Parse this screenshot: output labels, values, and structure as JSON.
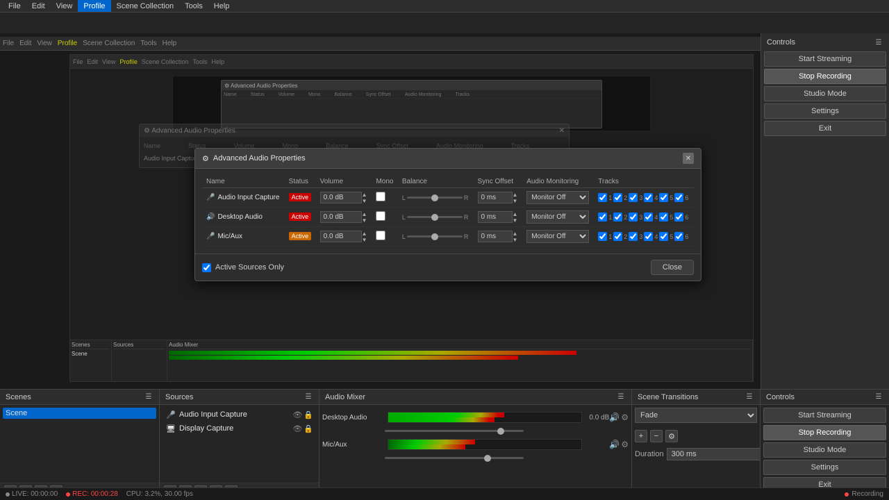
{
  "menubar": {
    "items": [
      "File",
      "Edit",
      "View",
      "Profile",
      "Scene Collection",
      "Tools",
      "Help"
    ]
  },
  "obs_menubar": {
    "items": [
      "File",
      "Edit",
      "View",
      "Profile",
      "Scene Collection",
      "Tools",
      "Help"
    ]
  },
  "dialog": {
    "title": "Advanced Audio Properties",
    "icon": "⚙",
    "columns": [
      "Name",
      "Status",
      "Volume",
      "Mono",
      "Balance",
      "Sync Offset",
      "Audio Monitoring",
      "Tracks"
    ],
    "rows": [
      {
        "name": "Audio Input Capture",
        "status": "Active",
        "volume": "0.0 dB",
        "mono": false,
        "balance_l": "L",
        "balance_r": "R",
        "sync_offset": "0 ms",
        "monitoring": "Monitor Off",
        "tracks": [
          true,
          true,
          true,
          true,
          true,
          true
        ]
      },
      {
        "name": "Desktop Audio",
        "status": "Active",
        "volume": "0.0 dB",
        "mono": false,
        "balance_l": "L",
        "balance_r": "R",
        "sync_offset": "0 ms",
        "monitoring": "Monitor Off",
        "tracks": [
          true,
          true,
          true,
          true,
          true,
          true
        ]
      },
      {
        "name": "Mic/Aux",
        "status": "Active",
        "volume": "0.0 dB",
        "mono": false,
        "balance_l": "L",
        "balance_r": "R",
        "sync_offset": "0 ms",
        "monitoring": "Monitor Off",
        "tracks": [
          true,
          true,
          true,
          true,
          true,
          true
        ]
      }
    ],
    "footer": {
      "active_sources_label": "Active Sources Only",
      "close_label": "Close"
    }
  },
  "scenes_panel": {
    "title": "Scenes",
    "items": [
      "Scene"
    ],
    "selected": "Scene"
  },
  "sources_panel": {
    "title": "Sources",
    "items": [
      {
        "name": "Audio Input Capture",
        "type": "audio"
      },
      {
        "name": "Display Capture",
        "type": "display"
      }
    ]
  },
  "audio_mixer_panel": {
    "title": "Audio Mixer",
    "tracks": [
      {
        "name": "Desktop Audio",
        "db": "0.0 dB"
      },
      {
        "name": "Mic/Aux",
        "db": ""
      }
    ]
  },
  "scene_transitions_panel": {
    "title": "Scene Transitions",
    "transition": "Fade",
    "duration_label": "Duration",
    "duration_value": "300 ms"
  },
  "controls_panel": {
    "title": "Controls",
    "buttons": [
      {
        "label": "Start Streaming",
        "id": "start-streaming"
      },
      {
        "label": "Stop Recording",
        "id": "stop-recording"
      },
      {
        "label": "Studio Mode",
        "id": "studio-mode"
      },
      {
        "label": "Settings",
        "id": "settings"
      },
      {
        "label": "Exit",
        "id": "exit"
      }
    ]
  },
  "status_bar": {
    "live_label": "LIVE: 00:00:00",
    "rec_label": "REC: 00:00:28",
    "cpu_label": "CPU: 3.2%, 30.00 fps",
    "recording_label": "Recording"
  },
  "icons": {
    "mic": "🎤",
    "speaker": "🔊",
    "gear": "⚙",
    "plus": "+",
    "minus": "−",
    "up": "▲",
    "down": "▼",
    "settings": "⚙",
    "eye": "👁",
    "lock": "🔒",
    "close": "✕",
    "dialog_icon": "⚙"
  }
}
